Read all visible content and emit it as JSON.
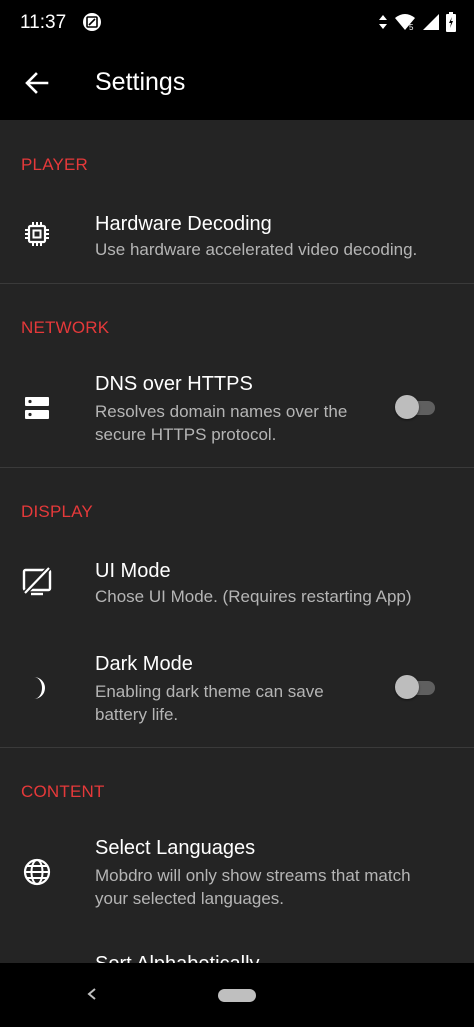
{
  "status_bar": {
    "time": "11:37"
  },
  "app_bar": {
    "title": "Settings"
  },
  "sections": [
    {
      "header": "PLAYER",
      "items": [
        {
          "title": "Hardware Decoding",
          "subtitle": "Use hardware accelerated video decoding.",
          "icon": "chip-icon"
        }
      ]
    },
    {
      "header": "NETWORK",
      "items": [
        {
          "title": "DNS over HTTPS",
          "subtitle_line1": "Resolves domain names over the",
          "subtitle_line2": "secure HTTPS protocol.",
          "icon": "dns-icon",
          "toggle": false
        }
      ]
    },
    {
      "header": "DISPLAY",
      "items": [
        {
          "title": "UI Mode",
          "subtitle": "Chose UI Mode. (Requires restarting App)",
          "icon": "ui-mode-icon"
        },
        {
          "title": "Dark Mode",
          "subtitle_line1": "Enabling dark theme can save",
          "subtitle_line2": "battery life.",
          "icon": "moon-icon",
          "toggle": false
        }
      ]
    },
    {
      "header": "CONTENT",
      "items": [
        {
          "title": "Select Languages",
          "subtitle_line1": "Mobdro will only show streams that match",
          "subtitle_line2": "your selected languages.",
          "icon": "globe-icon"
        },
        {
          "title": "Sort Alphabetically",
          "icon": "sort-icon"
        }
      ]
    }
  ],
  "colors": {
    "accent": "#e5393a",
    "background": "#242424",
    "bar": "#000000",
    "subtitle": "#b5b5b5"
  }
}
